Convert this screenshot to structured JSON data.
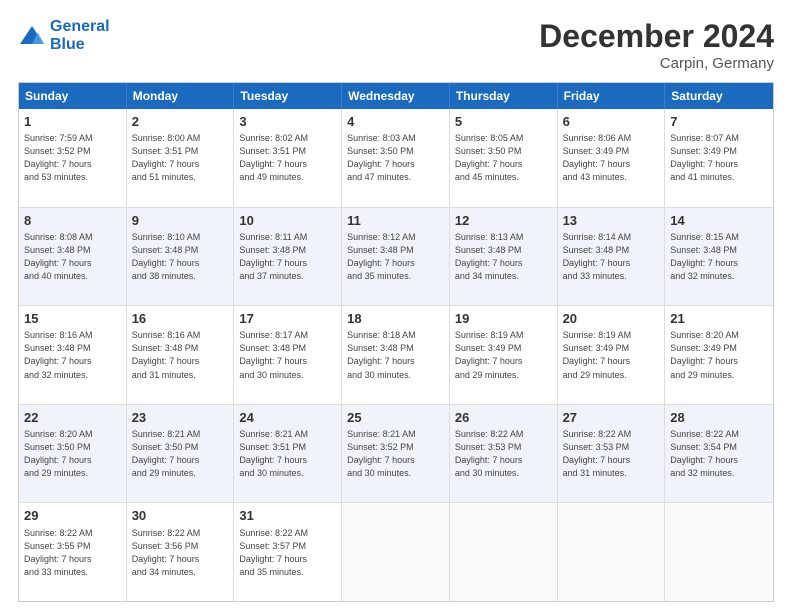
{
  "header": {
    "logo_line1": "General",
    "logo_line2": "Blue",
    "month": "December 2024",
    "location": "Carpin, Germany"
  },
  "days": [
    "Sunday",
    "Monday",
    "Tuesday",
    "Wednesday",
    "Thursday",
    "Friday",
    "Saturday"
  ],
  "weeks": [
    [
      {
        "day": "1",
        "sunrise": "7:59 AM",
        "sunset": "3:52 PM",
        "daylight": "7 hours and 53 minutes."
      },
      {
        "day": "2",
        "sunrise": "8:00 AM",
        "sunset": "3:51 PM",
        "daylight": "7 hours and 51 minutes."
      },
      {
        "day": "3",
        "sunrise": "8:02 AM",
        "sunset": "3:51 PM",
        "daylight": "7 hours and 49 minutes."
      },
      {
        "day": "4",
        "sunrise": "8:03 AM",
        "sunset": "3:50 PM",
        "daylight": "7 hours and 47 minutes."
      },
      {
        "day": "5",
        "sunrise": "8:05 AM",
        "sunset": "3:50 PM",
        "daylight": "7 hours and 45 minutes."
      },
      {
        "day": "6",
        "sunrise": "8:06 AM",
        "sunset": "3:49 PM",
        "daylight": "7 hours and 43 minutes."
      },
      {
        "day": "7",
        "sunrise": "8:07 AM",
        "sunset": "3:49 PM",
        "daylight": "7 hours and 41 minutes."
      }
    ],
    [
      {
        "day": "8",
        "sunrise": "8:08 AM",
        "sunset": "3:48 PM",
        "daylight": "7 hours and 40 minutes."
      },
      {
        "day": "9",
        "sunrise": "8:10 AM",
        "sunset": "3:48 PM",
        "daylight": "7 hours and 38 minutes."
      },
      {
        "day": "10",
        "sunrise": "8:11 AM",
        "sunset": "3:48 PM",
        "daylight": "7 hours and 37 minutes."
      },
      {
        "day": "11",
        "sunrise": "8:12 AM",
        "sunset": "3:48 PM",
        "daylight": "7 hours and 35 minutes."
      },
      {
        "day": "12",
        "sunrise": "8:13 AM",
        "sunset": "3:48 PM",
        "daylight": "7 hours and 34 minutes."
      },
      {
        "day": "13",
        "sunrise": "8:14 AM",
        "sunset": "3:48 PM",
        "daylight": "7 hours and 33 minutes."
      },
      {
        "day": "14",
        "sunrise": "8:15 AM",
        "sunset": "3:48 PM",
        "daylight": "7 hours and 32 minutes."
      }
    ],
    [
      {
        "day": "15",
        "sunrise": "8:16 AM",
        "sunset": "3:48 PM",
        "daylight": "7 hours and 32 minutes."
      },
      {
        "day": "16",
        "sunrise": "8:16 AM",
        "sunset": "3:48 PM",
        "daylight": "7 hours and 31 minutes."
      },
      {
        "day": "17",
        "sunrise": "8:17 AM",
        "sunset": "3:48 PM",
        "daylight": "7 hours and 30 minutes."
      },
      {
        "day": "18",
        "sunrise": "8:18 AM",
        "sunset": "3:48 PM",
        "daylight": "7 hours and 30 minutes."
      },
      {
        "day": "19",
        "sunrise": "8:19 AM",
        "sunset": "3:49 PM",
        "daylight": "7 hours and 29 minutes."
      },
      {
        "day": "20",
        "sunrise": "8:19 AM",
        "sunset": "3:49 PM",
        "daylight": "7 hours and 29 minutes."
      },
      {
        "day": "21",
        "sunrise": "8:20 AM",
        "sunset": "3:49 PM",
        "daylight": "7 hours and 29 minutes."
      }
    ],
    [
      {
        "day": "22",
        "sunrise": "8:20 AM",
        "sunset": "3:50 PM",
        "daylight": "7 hours and 29 minutes."
      },
      {
        "day": "23",
        "sunrise": "8:21 AM",
        "sunset": "3:50 PM",
        "daylight": "7 hours and 29 minutes."
      },
      {
        "day": "24",
        "sunrise": "8:21 AM",
        "sunset": "3:51 PM",
        "daylight": "7 hours and 30 minutes."
      },
      {
        "day": "25",
        "sunrise": "8:21 AM",
        "sunset": "3:52 PM",
        "daylight": "7 hours and 30 minutes."
      },
      {
        "day": "26",
        "sunrise": "8:22 AM",
        "sunset": "3:53 PM",
        "daylight": "7 hours and 30 minutes."
      },
      {
        "day": "27",
        "sunrise": "8:22 AM",
        "sunset": "3:53 PM",
        "daylight": "7 hours and 31 minutes."
      },
      {
        "day": "28",
        "sunrise": "8:22 AM",
        "sunset": "3:54 PM",
        "daylight": "7 hours and 32 minutes."
      }
    ],
    [
      {
        "day": "29",
        "sunrise": "8:22 AM",
        "sunset": "3:55 PM",
        "daylight": "7 hours and 33 minutes."
      },
      {
        "day": "30",
        "sunrise": "8:22 AM",
        "sunset": "3:56 PM",
        "daylight": "7 hours and 34 minutes."
      },
      {
        "day": "31",
        "sunrise": "8:22 AM",
        "sunset": "3:57 PM",
        "daylight": "7 hours and 35 minutes."
      },
      null,
      null,
      null,
      null
    ]
  ],
  "labels": {
    "sunrise": "Sunrise:",
    "sunset": "Sunset:",
    "daylight": "Daylight:"
  }
}
